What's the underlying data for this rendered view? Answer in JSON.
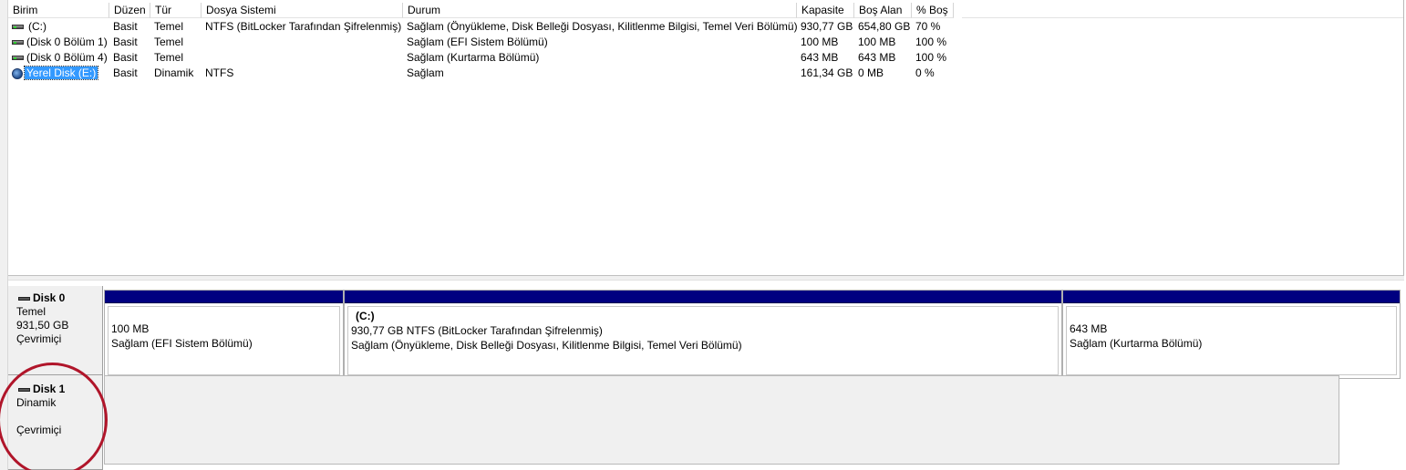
{
  "volume_list": {
    "columns": [
      {
        "key": "birim",
        "label": "Birim"
      },
      {
        "key": "duzen",
        "label": "Düzen"
      },
      {
        "key": "tur",
        "label": "Tür"
      },
      {
        "key": "dosya",
        "label": "Dosya Sistemi"
      },
      {
        "key": "durum",
        "label": "Durum"
      },
      {
        "key": "kapasite",
        "label": "Kapasite"
      },
      {
        "key": "bos",
        "label": "Boş Alan"
      },
      {
        "key": "yuzde",
        "label": "% Boş"
      }
    ],
    "rows": [
      {
        "icon": "basic-volume-icon",
        "birim": "(C:)",
        "duzen": "Basit",
        "tur": "Temel",
        "dosya": "NTFS (BitLocker Tarafından Şifrelenmiş)",
        "durum": "Sağlam (Önyükleme, Disk Belleği Dosyası, Kilitlenme Bilgisi, Temel Veri Bölümü)",
        "kapasite": "930,77 GB",
        "bos": "654,80 GB",
        "yuzde": "70 %"
      },
      {
        "icon": "basic-volume-icon",
        "birim": "(Disk 0 Bölüm 1)",
        "duzen": "Basit",
        "tur": "Temel",
        "dosya": "",
        "durum": "Sağlam (EFI Sistem Bölümü)",
        "kapasite": "100 MB",
        "bos": "100 MB",
        "yuzde": "100 %"
      },
      {
        "icon": "basic-volume-icon",
        "birim": "(Disk 0 Bölüm 4)",
        "duzen": "Basit",
        "tur": "Temel",
        "dosya": "",
        "durum": "Sağlam (Kurtarma Bölümü)",
        "kapasite": "643 MB",
        "bos": "643 MB",
        "yuzde": "100 %"
      },
      {
        "icon": "dynamic-volume-icon",
        "birim": "Yerel Disk (E:)",
        "duzen": "Basit",
        "tur": "Dinamik",
        "dosya": "NTFS",
        "durum": "Sağlam",
        "kapasite": "161,34 GB",
        "bos": "0 MB",
        "yuzde": "0 %",
        "selected": true
      }
    ]
  },
  "disks": [
    {
      "name": "Disk 0",
      "type": "Temel",
      "size": "931,50 GB",
      "status": "Çevrimiçi",
      "partitions": [
        {
          "title": "",
          "line1": "100 MB",
          "line2": "Sağlam (EFI Sistem Bölümü)"
        },
        {
          "title": "(C:)",
          "line1": "930,77 GB NTFS (BitLocker Tarafından Şifrelenmiş)",
          "line2": "Sağlam (Önyükleme, Disk Belleği Dosyası, Kilitlenme Bilgisi, Temel Veri Bölümü)"
        },
        {
          "title": "",
          "line1": "643 MB",
          "line2": "Sağlam (Kurtarma Bölümü)"
        }
      ]
    },
    {
      "name": "Disk 1",
      "type": "Dinamik",
      "size": "",
      "status": "Çevrimiçi",
      "partitions": []
    }
  ],
  "colors": {
    "partition_stripe": "#000080",
    "selection": "#3399ff",
    "annotation": "#b0152a"
  }
}
